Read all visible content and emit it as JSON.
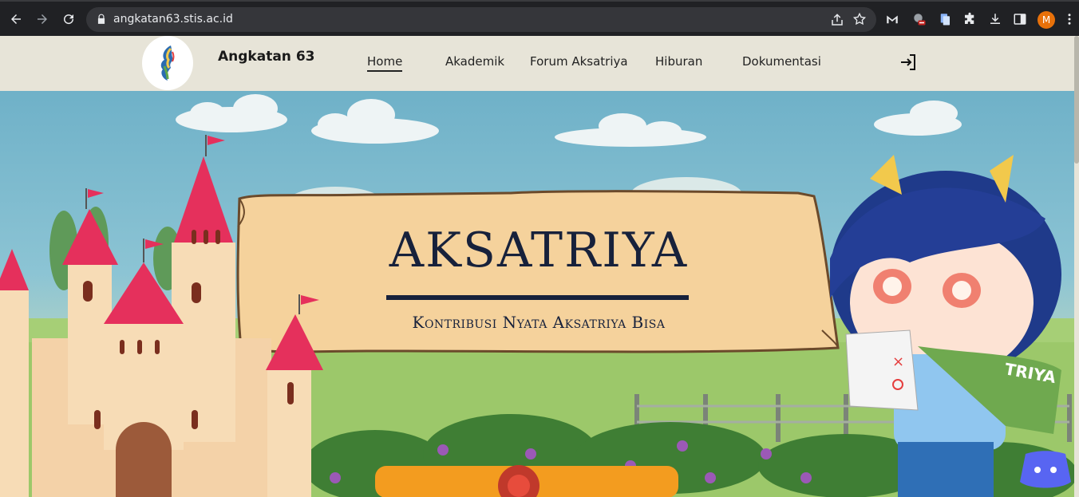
{
  "browser": {
    "url": "angkatan63.stis.ac.id",
    "profile_initial": "M",
    "icons": [
      "back-arrow-icon",
      "forward-arrow-icon",
      "reload-icon",
      "lock-icon",
      "share-icon",
      "star-icon",
      "extension-icon",
      "puzzle-icon",
      "download-icon",
      "sidebar-icon",
      "menu-dots-icon"
    ]
  },
  "site": {
    "title": "Angkatan 63",
    "menu": [
      {
        "label": "Home",
        "active": true
      },
      {
        "label": "Akademik",
        "active": false
      },
      {
        "label": "Forum Aksatriya",
        "active": false
      },
      {
        "label": "Hiburan",
        "active": false
      },
      {
        "label": "Dokumentasi",
        "active": false
      }
    ]
  },
  "hero": {
    "title": "AKSATRIYA",
    "subtitle": "Kontribusi Nyata Aksatriya Bisa",
    "character_scarf_text": "TRIYA"
  },
  "colors": {
    "header_bg": "#e7e4d8",
    "sky": "#6fb1c8",
    "grass": "#9cc86a",
    "parchment": "#f5d29c",
    "title_ink": "#17213b",
    "profile": "#e8710a"
  }
}
